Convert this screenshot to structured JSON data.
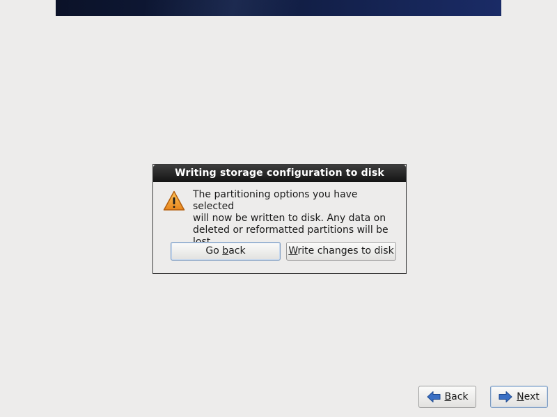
{
  "dialog": {
    "title": "Writing storage configuration to disk",
    "message": "The partitioning options you have selected\nwill now be written to disk.  Any data on\ndeleted or reformatted partitions will be lost.",
    "icon": "warning-icon",
    "buttons": {
      "go_back": {
        "pre": "Go ",
        "mnemonic": "b",
        "post": "ack"
      },
      "write": {
        "pre": "",
        "mnemonic": "W",
        "post": "rite changes to disk"
      }
    }
  },
  "nav": {
    "back": {
      "mnemonic": "B",
      "post": "ack",
      "icon": "arrow-left-icon"
    },
    "next": {
      "mnemonic": "N",
      "post": "ext",
      "icon": "arrow-right-icon"
    }
  },
  "colors": {
    "background": "#edeceb",
    "titlebar": "#1f1f1f",
    "warning": "#f0a030",
    "arrow": "#3a6fc4"
  }
}
